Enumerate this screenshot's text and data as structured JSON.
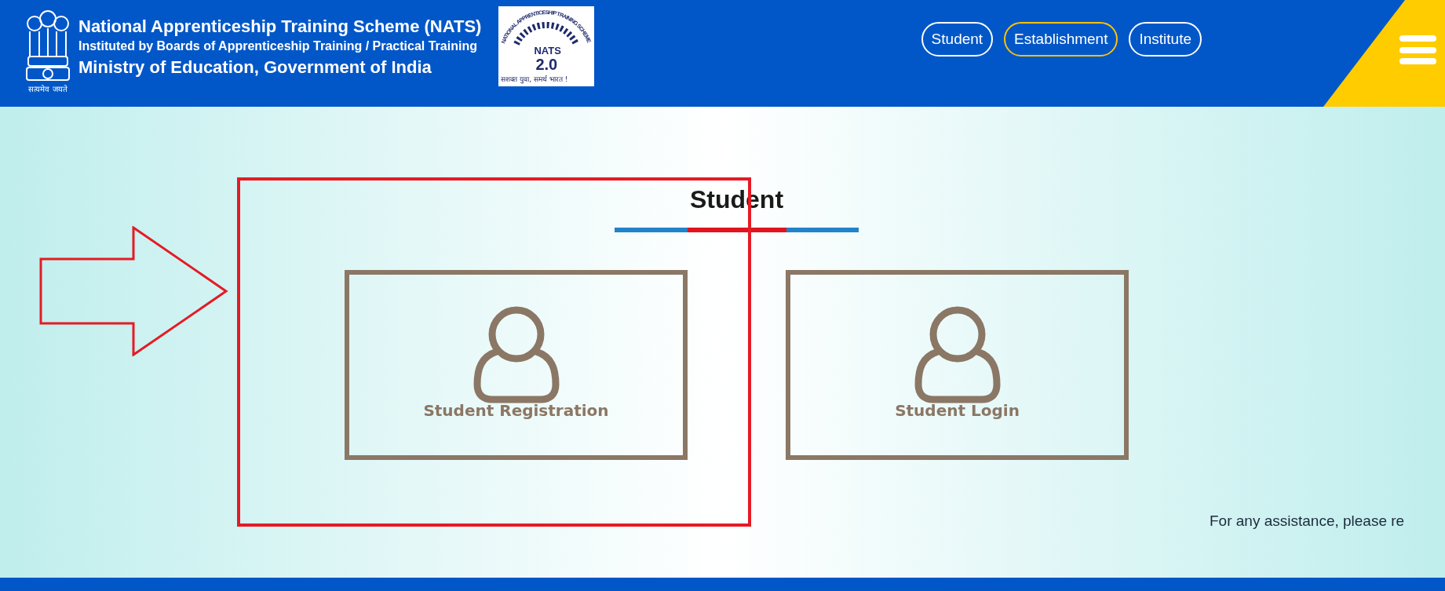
{
  "header": {
    "emblem_motto": "सत्यमेव जयते",
    "title": "National Apprenticeship Training Scheme (NATS)",
    "subtitle": "Instituted by Boards of Apprenticeship Training / Practical Training",
    "ministry": "Ministry of Education, Government of India",
    "logo": {
      "ring_text": "NATIONAL APPRENTICESHIP TRAINING SCHEME",
      "name": "NATS",
      "version": "2.0",
      "tagline": "सशक्त युवा, समर्थ भारत !"
    }
  },
  "nav": [
    {
      "label": "Student",
      "selected": false
    },
    {
      "label": "Establishment",
      "selected": true
    },
    {
      "label": "Institute",
      "selected": false
    }
  ],
  "section": {
    "title": "Student",
    "cards": [
      {
        "label": "Student Registration"
      },
      {
        "label": "Student Login"
      }
    ]
  },
  "assistance": "For any assistance, please re"
}
